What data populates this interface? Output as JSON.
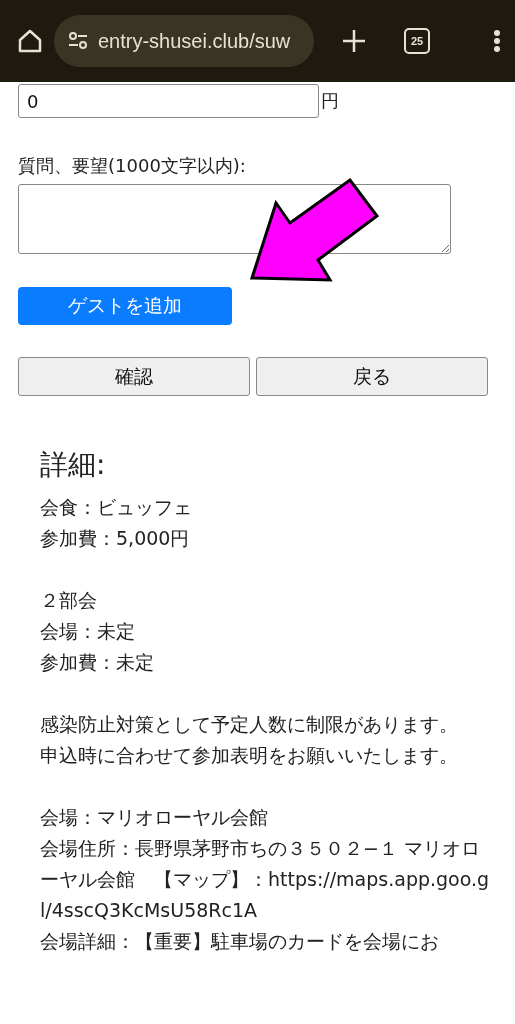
{
  "browser": {
    "url": "entry-shusei.club/suw",
    "tab_count": "25"
  },
  "fee_field": {
    "value": "0",
    "unit": "円"
  },
  "comment_field": {
    "label": "質問、要望(1000文字以内):"
  },
  "add_guest_button": "ゲストを追加",
  "buttons": [
    "確認",
    "戻る"
  ],
  "details": {
    "heading": "詳細:",
    "paragraphs": [
      [
        "会食：ビュッフェ",
        "参加費：5,000円"
      ],
      [
        "２部会",
        "会場：未定",
        "参加費：未定"
      ],
      [
        "感染防止対策として予定人数に制限があります。",
        "申込時に合わせて参加表明をお願いいたします。"
      ],
      [
        "会場：マリオローヤル会館",
        "会場住所：長野県茅野市ちの３５０２−１ マリオローヤル会館　【マップ】：https://maps.app.goo.gl/4sscQ3KcMsU58Rc1A",
        "会場詳細：【重要】駐車場のカードを会場にお"
      ]
    ]
  }
}
